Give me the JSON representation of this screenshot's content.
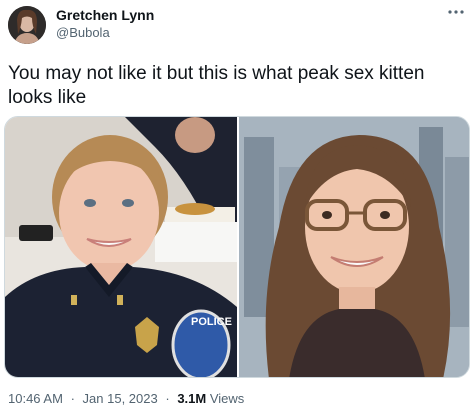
{
  "author": {
    "name": "Gretchen Lynn",
    "handle": "@Bubola",
    "avatar_icon": "profile-photo"
  },
  "more_icon": "more-options-icon",
  "tweet": {
    "text": "You may not like it but this is what peak sex kitten looks like"
  },
  "media": {
    "left_photo": "photo-police-officer",
    "right_photo": "photo-woman-glasses",
    "patch_text": "POLICE"
  },
  "meta": {
    "time": "10:46 AM",
    "separator": "·",
    "date": "Jan 15, 2023",
    "views_count": "3.1M",
    "views_label": "Views"
  },
  "colors": {
    "text_primary": "#0f1419",
    "text_secondary": "#536471",
    "border": "#cfd9de"
  }
}
